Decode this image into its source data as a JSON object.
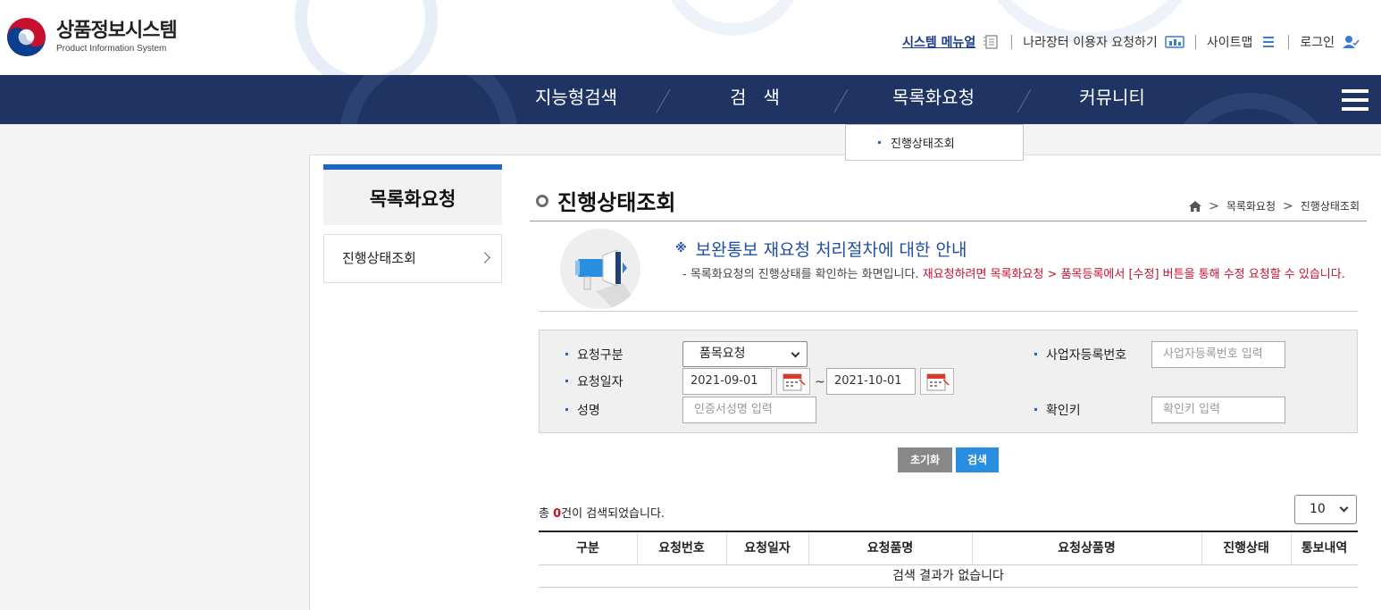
{
  "header": {
    "logo_ko": "상품정보시스템",
    "logo_en": "Product Information System",
    "util": {
      "manual": "시스템 메뉴얼",
      "request": "나라장터 이용자 요청하기",
      "sitemap": "사이트맵",
      "login": "로그인"
    }
  },
  "gnb": {
    "items": [
      "지능형검색",
      "검   색",
      "목록화요청",
      "커뮤니티"
    ],
    "dropdown": [
      "진행상태조회"
    ]
  },
  "lnb": {
    "title": "목록화요청",
    "items": [
      "진행상태조회"
    ]
  },
  "page": {
    "title": "진행상태조회",
    "breadcrumb": [
      "목록화요청",
      "진행상태조회"
    ]
  },
  "notice": {
    "mark": "※",
    "title": "보완통보 재요청 처리절차에 대한 안내",
    "desc_dash": "-",
    "desc_normal": "목록화요청의 진행상태를 확인하는 화면입니다.",
    "desc_red": "재요청하려면 목록화요청 > 품목등록에서 [수정] 버튼을 통해 수정 요청할 수 있습니다."
  },
  "search": {
    "req_type_label": "요청구분",
    "req_type_value": "품목요청",
    "req_date_label": "요청일자",
    "date_from": "2021-09-01",
    "date_sep": "~",
    "date_to": "2021-10-01",
    "name_label": "성명",
    "name_placeholder": "인증서성명 입력",
    "bizno_label": "사업자등록번호",
    "bizno_placeholder": "사업자등록번호 입력",
    "key_label": "확인키",
    "key_placeholder": "확인키 입력",
    "reset_button": "초기화",
    "search_button": "검색"
  },
  "result": {
    "count_prefix": "총 ",
    "count": "0",
    "count_suffix": "건이 검색되었습니다.",
    "page_size": "10",
    "columns": [
      "구분",
      "요청번호",
      "요청일자",
      "요청품명",
      "요청상품명",
      "진행상태",
      "통보내역"
    ],
    "empty_message": "검색 결과가 없습니다"
  },
  "colors": {
    "gnb_bg": "#203463",
    "accent_blue": "#1f66c3",
    "search_button": "#2a8ee0",
    "alert_red": "#c8102e"
  }
}
